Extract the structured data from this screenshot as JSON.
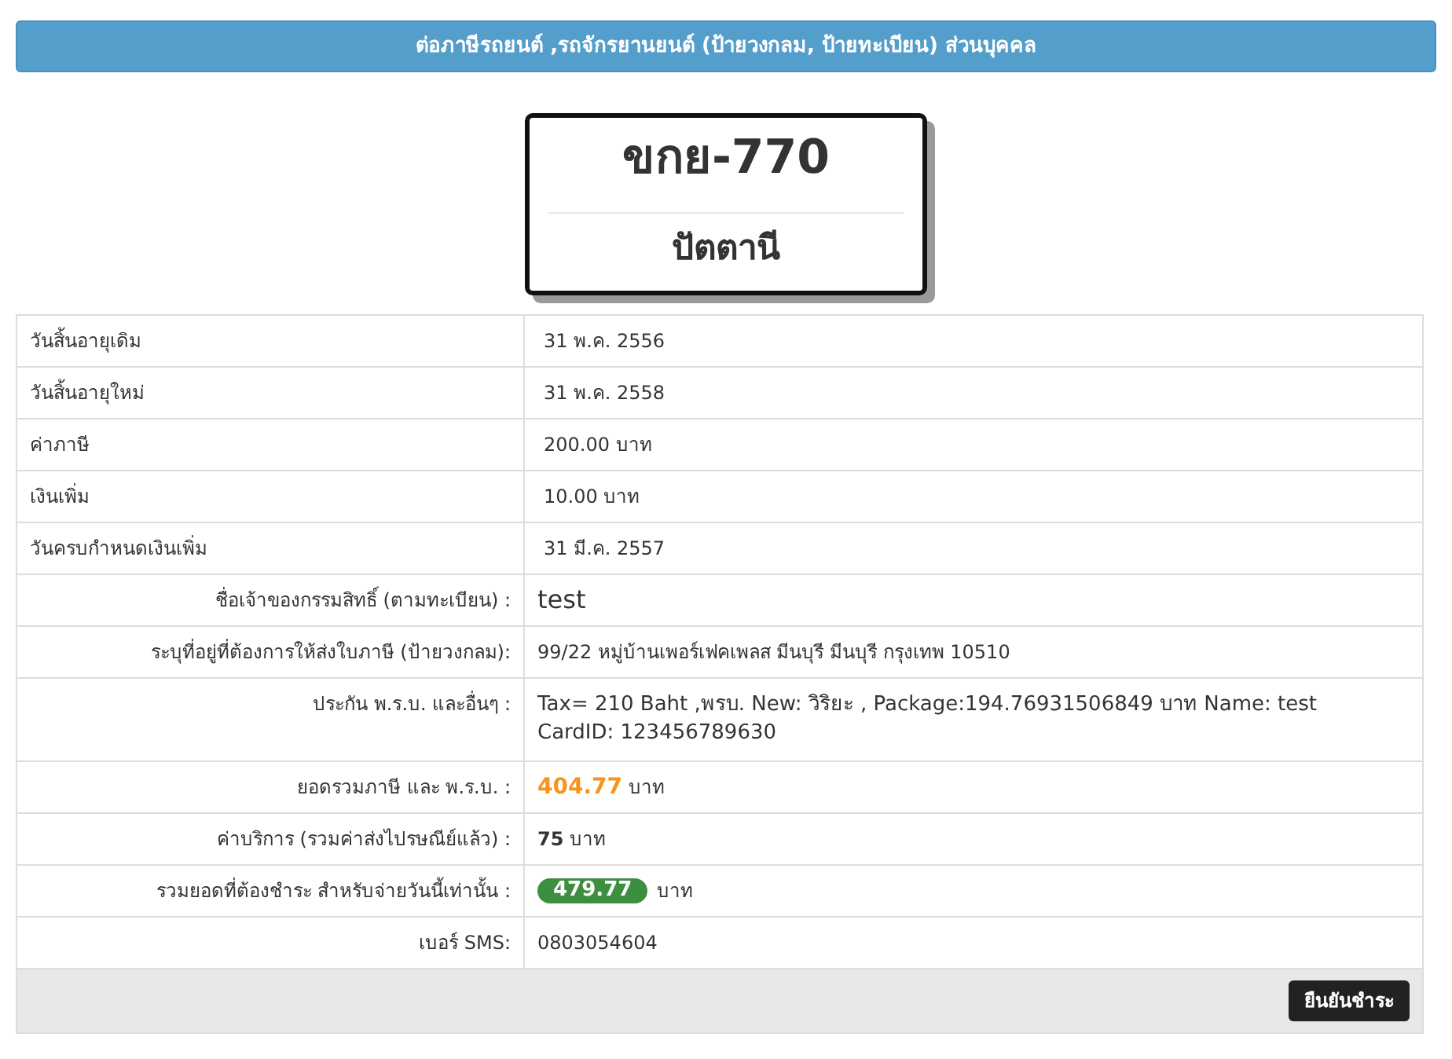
{
  "header": {
    "title": "ต่อภาษีรถยนต์ ,รถจักรยานยนต์ (ป้ายวงกลม, ป้ายทะเบียน) ส่วนบุคคล"
  },
  "plate": {
    "number": "ขกย-770",
    "province": "ปัตตานี"
  },
  "rows": [
    {
      "kind": "plain",
      "label": "วันสิ้นอายุเดิม",
      "value": {
        "kind": "text",
        "text": "31 พ.ค. 2556"
      }
    },
    {
      "kind": "plain",
      "label": "วันสิ้นอายุใหม่",
      "value": {
        "kind": "text",
        "text": "31 พ.ค. 2558"
      }
    },
    {
      "kind": "plain",
      "label": "ค่าภาษี",
      "value": {
        "kind": "text",
        "text": "200.00 บาท"
      }
    },
    {
      "kind": "plain",
      "label": "เงินเพิ่ม",
      "value": {
        "kind": "text",
        "text": "10.00 บาท"
      }
    },
    {
      "kind": "plain",
      "label": "วันครบกำหนดเงินเพิ่ม",
      "value": {
        "kind": "text",
        "text": "31 มี.ค. 2557"
      }
    },
    {
      "kind": "detail",
      "label": "ชื่อเจ้าของกรรมสิทธิ์ (ตามทะเบียน) :",
      "value": {
        "kind": "large",
        "text": "test"
      }
    },
    {
      "kind": "detail",
      "label": "ระบุที่อยู่ที่ต้องการให้ส่งใบภาษี (ป้ายวงกลม):",
      "value": {
        "kind": "text",
        "text": "99/22 หมู่บ้านเพอร์เฟคเพลส มีนบุรี มีนบุรี กรุงเทพ 10510"
      }
    },
    {
      "kind": "detail",
      "label": "ประกัน พ.ร.บ. และอื่นๆ :",
      "value": {
        "kind": "lines",
        "lines": [
          "Tax= 210 Baht ,พรบ. New: วิริยะ , Package:194.76931506849 บาท Name: test",
          "CardID: 123456789630"
        ]
      }
    },
    {
      "kind": "detail",
      "label": "ยอดรวมภาษี และ พ.ร.บ. :",
      "value": {
        "kind": "highlight",
        "text": "404.77",
        "unit": "บาท"
      }
    },
    {
      "kind": "detail",
      "label": "ค่าบริการ (รวมค่าส่งไปรษณีย์แล้ว) :",
      "value": {
        "kind": "bold",
        "text": "75",
        "unit": "บาท"
      }
    },
    {
      "kind": "detail",
      "label": "รวมยอดที่ต้องชำระ สำหรับจ่ายวันนี้เท่านั้น :",
      "value": {
        "kind": "badge",
        "text": "479.77",
        "unit": "บาท"
      }
    },
    {
      "kind": "detail",
      "label": "เบอร์ SMS:",
      "value": {
        "kind": "text",
        "text": "0803054604"
      }
    }
  ],
  "confirm_button": "ยืนยันชำระ"
}
